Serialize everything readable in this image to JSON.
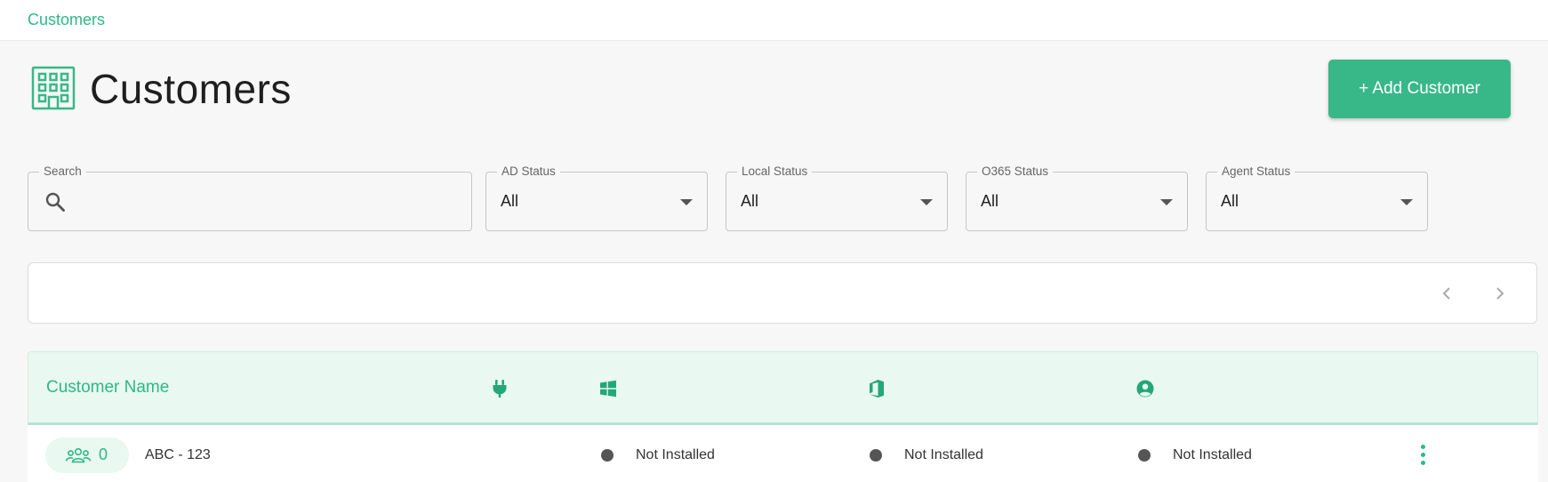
{
  "breadcrumb": {
    "label": "Customers"
  },
  "header": {
    "title": "Customers",
    "add_button_label": "+ Add Customer"
  },
  "filters": {
    "search": {
      "label": "Search",
      "value": "",
      "icon": "search-icon"
    },
    "ad_status": {
      "label": "AD Status",
      "value": "All"
    },
    "local_status": {
      "label": "Local Status",
      "value": "All"
    },
    "o365_status": {
      "label": "O365 Status",
      "value": "All"
    },
    "agent_status": {
      "label": "Agent Status",
      "value": "All"
    }
  },
  "pagination": {
    "prev_icon": "chevron-left-icon",
    "next_icon": "chevron-right-icon"
  },
  "table": {
    "columns": [
      {
        "label": "Customer Name"
      },
      {
        "icon": "plug-icon"
      },
      {
        "icon": "windows-icon"
      },
      {
        "icon": "office-icon"
      },
      {
        "icon": "user-circle-icon"
      }
    ],
    "rows": [
      {
        "user_count": "0",
        "name": "ABC - 123",
        "windows_status": "Not Installed",
        "office_status": "Not Installed",
        "agent_status": "Not Installed"
      }
    ]
  },
  "colors": {
    "accent": "#38b888",
    "accent_text": "#2eb887",
    "header_bg": "#e9f8f1",
    "status_dot": "#555555"
  }
}
